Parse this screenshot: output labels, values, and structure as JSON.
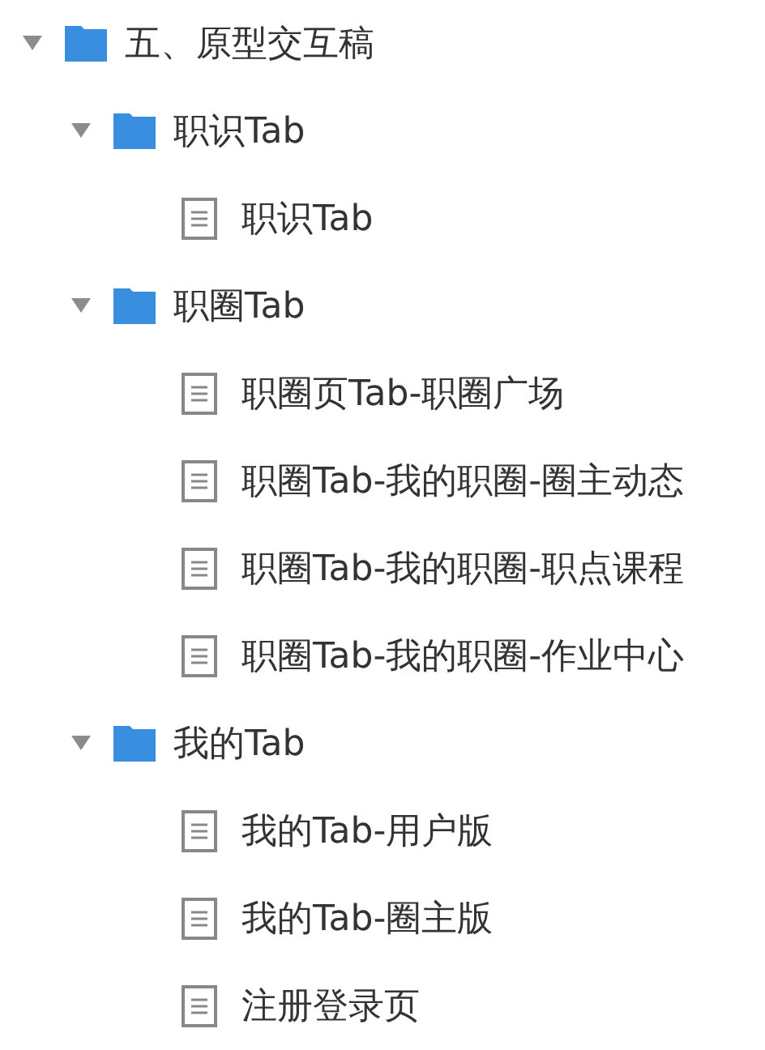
{
  "tree": [
    {
      "kind": "folder",
      "label": "五、原型交互稿",
      "expanded": true,
      "children": [
        {
          "kind": "folder",
          "label": "职识Tab",
          "expanded": true,
          "children": [
            {
              "kind": "file",
              "label": "职识Tab"
            }
          ]
        },
        {
          "kind": "folder",
          "label": "职圈Tab",
          "expanded": true,
          "children": [
            {
              "kind": "file",
              "label": "职圈页Tab-职圈广场"
            },
            {
              "kind": "file",
              "label": "职圈Tab-我的职圈-圈主动态"
            },
            {
              "kind": "file",
              "label": "职圈Tab-我的职圈-职点课程"
            },
            {
              "kind": "file",
              "label": "职圈Tab-我的职圈-作业中心"
            }
          ]
        },
        {
          "kind": "folder",
          "label": "我的Tab",
          "expanded": true,
          "children": [
            {
              "kind": "file",
              "label": "我的Tab-用户版"
            },
            {
              "kind": "file",
              "label": "我的Tab-圈主版"
            },
            {
              "kind": "file",
              "label": "注册登录页"
            }
          ]
        }
      ]
    }
  ]
}
